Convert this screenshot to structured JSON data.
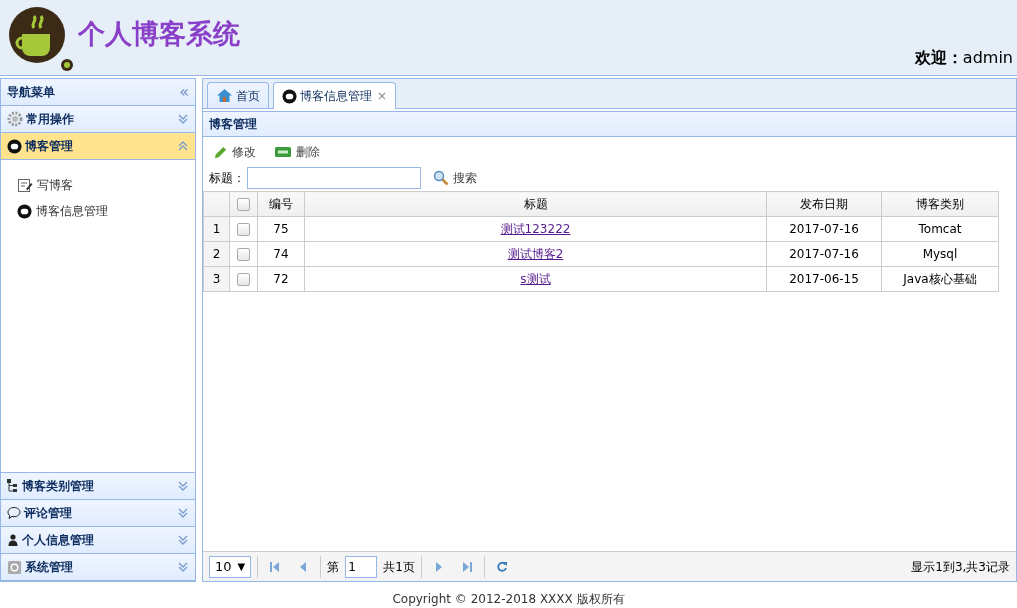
{
  "header": {
    "title": "个人博客系统",
    "welcome": "**欢迎：**admin"
  },
  "sidebar": {
    "title": "导航菜单",
    "collapse_glyph": "«",
    "panels": [
      {
        "title": "常用操作",
        "expanded": false
      },
      {
        "title": "博客管理",
        "expanded": true,
        "items": [
          {
            "label": "写博客"
          },
          {
            "label": "博客信息管理"
          }
        ]
      },
      {
        "title": "博客类别管理",
        "expanded": false
      },
      {
        "title": "评论管理",
        "expanded": false
      },
      {
        "title": "个人信息管理",
        "expanded": false
      },
      {
        "title": "系统管理",
        "expanded": false
      }
    ]
  },
  "tabs": [
    {
      "label": "首页",
      "selected": false
    },
    {
      "label": "博客信息管理",
      "selected": true,
      "close_glyph": "×"
    }
  ],
  "panel": {
    "title": "博客管理",
    "toolbar": [
      {
        "label": "修改"
      },
      {
        "label": "删除"
      }
    ],
    "search": {
      "label": "标题：",
      "button": "搜索"
    },
    "table": {
      "select_all_checked": false,
      "columns": [
        "编号",
        "标题",
        "发布日期",
        "博客类别"
      ],
      "rows": [
        {
          "index": "1",
          "checked": false,
          "id": "75",
          "title": "测试123222",
          "date": "2017-07-16",
          "type": "Tomcat"
        },
        {
          "index": "2",
          "checked": false,
          "id": "74",
          "title": "测试博客2",
          "date": "2017-07-16",
          "type": "Mysql"
        },
        {
          "index": "3",
          "checked": false,
          "id": "72",
          "title": "s测试",
          "date": "2017-06-15",
          "type": "Java核心基础"
        }
      ]
    },
    "pager": {
      "page_size": "10",
      "caret": "▼",
      "page_label": "第",
      "page": "1",
      "total_pages": "共1页",
      "summary": "显示1到3,共3记录"
    }
  },
  "footer": {
    "copyright": "Copyright © 2012-2018 XXXX 版权所有"
  }
}
